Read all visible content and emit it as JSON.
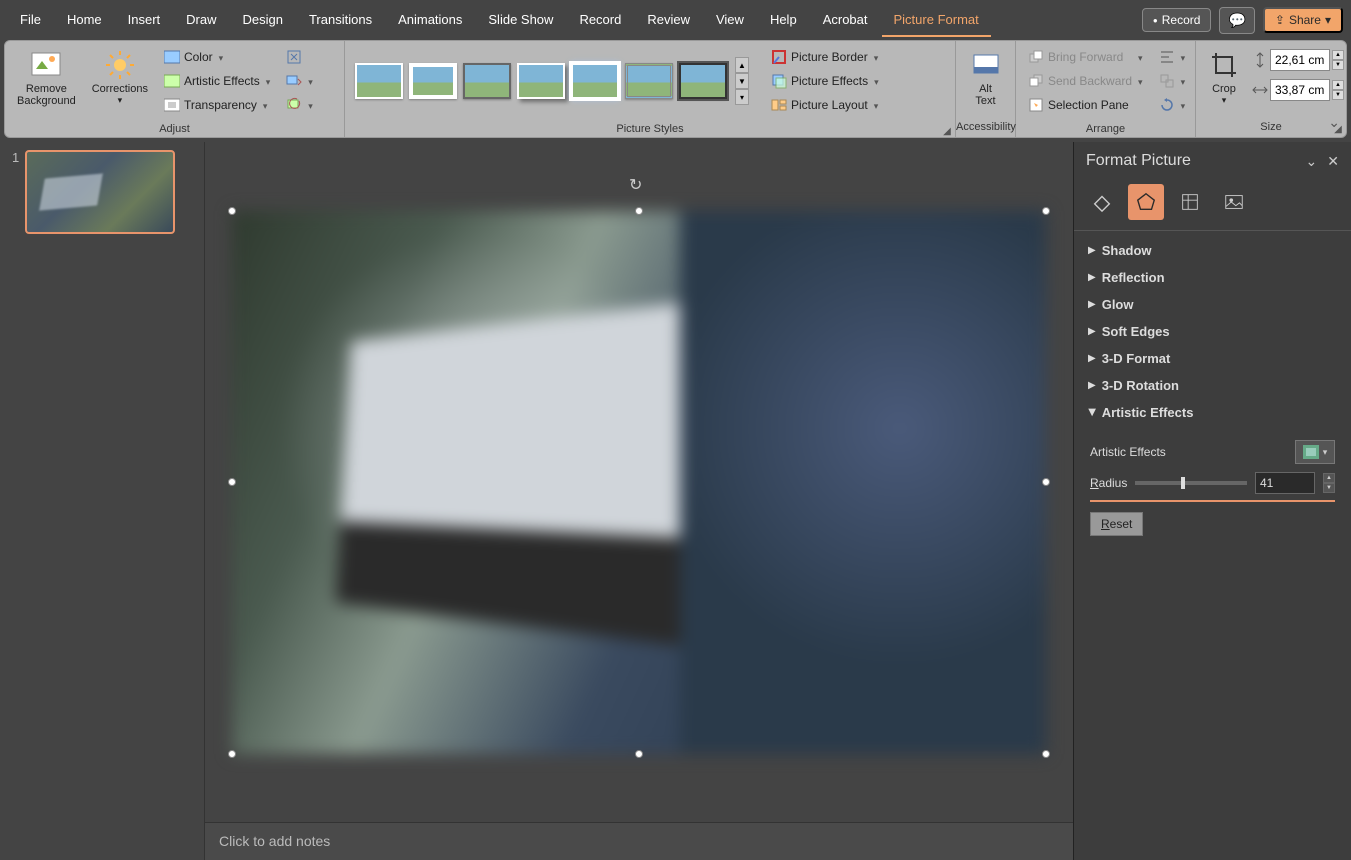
{
  "menubar": {
    "items": [
      "File",
      "Home",
      "Insert",
      "Draw",
      "Design",
      "Transitions",
      "Animations",
      "Slide Show",
      "Record",
      "Review",
      "View",
      "Help",
      "Acrobat",
      "Picture Format"
    ],
    "active_index": 13,
    "record": "Record",
    "share": "Share"
  },
  "ribbon": {
    "remove_bg": "Remove\nBackground",
    "corrections": "Corrections",
    "color": "Color",
    "artistic_effects": "Artistic Effects",
    "transparency": "Transparency",
    "adjust_label": "Adjust",
    "picture_styles_label": "Picture Styles",
    "picture_border": "Picture Border",
    "picture_effects": "Picture Effects",
    "picture_layout": "Picture Layout",
    "alt_text": "Alt\nText",
    "accessibility_label": "Accessibility",
    "bring_forward": "Bring Forward",
    "send_backward": "Send Backward",
    "selection_pane": "Selection Pane",
    "arrange_label": "Arrange",
    "crop": "Crop",
    "height": "22,61 cm",
    "width": "33,87 cm",
    "size_label": "Size"
  },
  "slides": {
    "items": [
      {
        "num": "1"
      }
    ]
  },
  "notes": {
    "placeholder": "Click to add notes"
  },
  "format_pane": {
    "title": "Format Picture",
    "sections": {
      "shadow": "Shadow",
      "reflection": "Reflection",
      "glow": "Glow",
      "soft_edges": "Soft Edges",
      "threed_format": "3-D Format",
      "threed_rotation": "3-D Rotation",
      "artistic_effects": "Artistic Effects"
    },
    "ae_label": "Artistic Effects",
    "radius_label": "Radius",
    "radius_value": "41",
    "reset": "Reset"
  }
}
